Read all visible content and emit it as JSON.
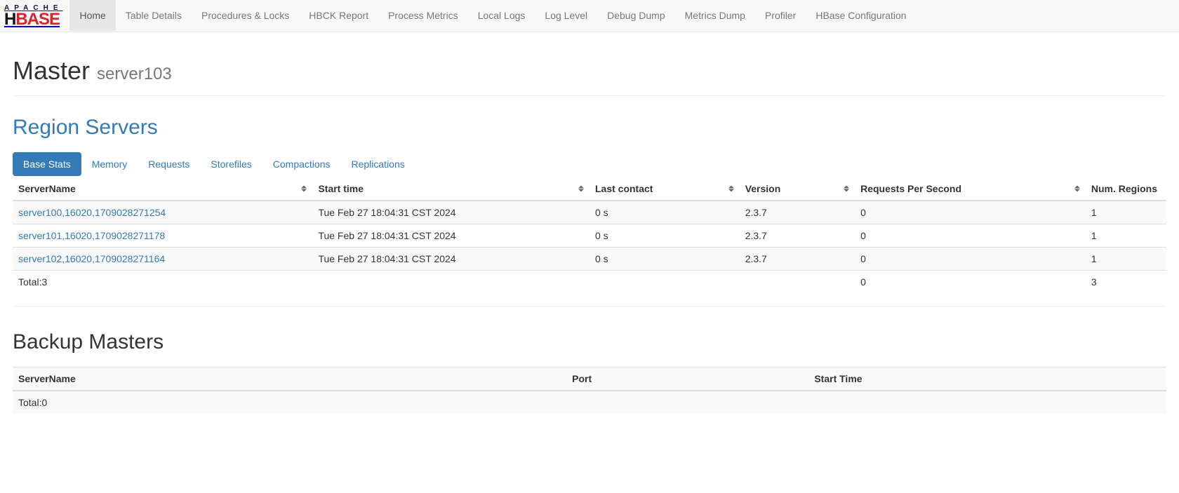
{
  "nav": {
    "items": [
      {
        "label": "Home",
        "active": true
      },
      {
        "label": "Table Details"
      },
      {
        "label": "Procedures & Locks"
      },
      {
        "label": "HBCK Report"
      },
      {
        "label": "Process Metrics"
      },
      {
        "label": "Local Logs"
      },
      {
        "label": "Log Level"
      },
      {
        "label": "Debug Dump"
      },
      {
        "label": "Metrics Dump"
      },
      {
        "label": "Profiler"
      },
      {
        "label": "HBase Configuration"
      }
    ]
  },
  "header": {
    "title": "Master",
    "subtitle": "server103"
  },
  "region_servers": {
    "heading": "Region Servers",
    "tabs": [
      {
        "label": "Base Stats",
        "active": true
      },
      {
        "label": "Memory"
      },
      {
        "label": "Requests"
      },
      {
        "label": "Storefiles"
      },
      {
        "label": "Compactions"
      },
      {
        "label": "Replications"
      }
    ],
    "columns": [
      "ServerName",
      "Start time",
      "Last contact",
      "Version",
      "Requests Per Second",
      "Num. Regions"
    ],
    "rows": [
      {
        "server": "server100,16020,1709028271254",
        "start": "Tue Feb 27 18:04:31 CST 2024",
        "last": "0 s",
        "version": "2.3.7",
        "rps": "0",
        "regions": "1"
      },
      {
        "server": "server101,16020,1709028271178",
        "start": "Tue Feb 27 18:04:31 CST 2024",
        "last": "0 s",
        "version": "2.3.7",
        "rps": "0",
        "regions": "1"
      },
      {
        "server": "server102,16020,1709028271164",
        "start": "Tue Feb 27 18:04:31 CST 2024",
        "last": "0 s",
        "version": "2.3.7",
        "rps": "0",
        "regions": "1"
      }
    ],
    "total": {
      "label": "Total:3",
      "rps": "0",
      "regions": "3"
    }
  },
  "backup_masters": {
    "heading": "Backup Masters",
    "columns": [
      "ServerName",
      "Port",
      "Start Time"
    ],
    "total": {
      "label": "Total:0"
    }
  }
}
